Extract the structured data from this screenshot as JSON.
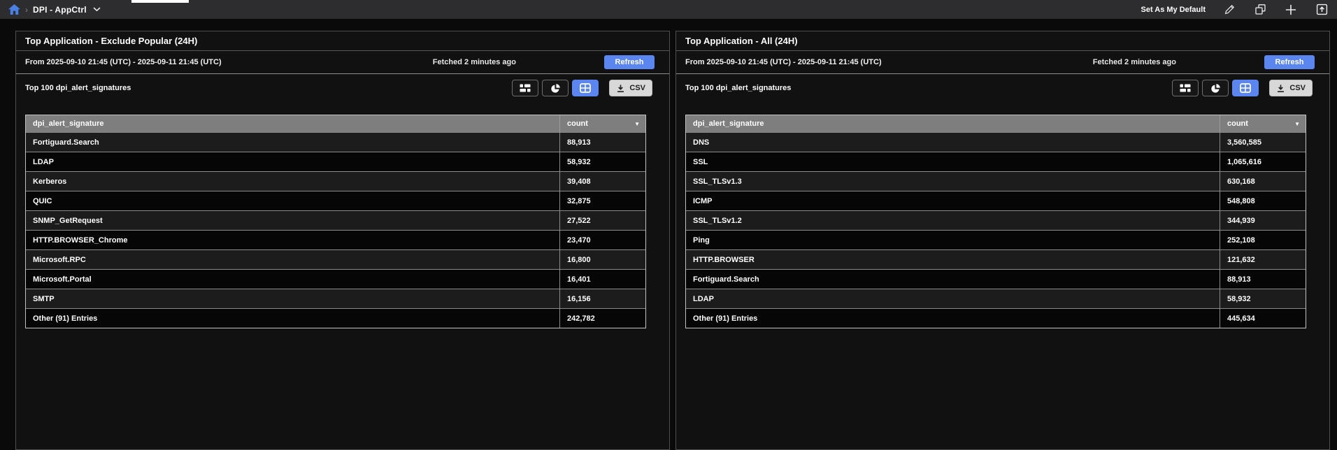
{
  "topbar": {
    "breadcrumb_title": "DPI - AppCtrl",
    "set_default_label": "Set As My Default",
    "icons": [
      "home-icon",
      "chevron-down-icon",
      "pencil-icon",
      "copy-icon",
      "plus-icon",
      "export-icon"
    ]
  },
  "colors": {
    "accent": "#5b86f0",
    "csv-bg": "#d8d8d8",
    "header-bg": "#7e7e7e",
    "topbar-bg": "#2d2d2f",
    "panel-border": "#4e4e4e"
  },
  "panels": [
    {
      "title": "Top Application - Exclude Popular (24H)",
      "date_range": "From 2025-09-10 21:45 (UTC) - 2025-09-11 21:45 (UTC)",
      "fetched": "Fetched 2 minutes ago",
      "refresh_label": "Refresh",
      "subtitle": "Top 100 dpi_alert_signatures",
      "csv_label": "CSV",
      "table": {
        "columns": [
          "dpi_alert_signature",
          "count"
        ],
        "sort_indicator": "▼",
        "rows": [
          [
            "Fortiguard.Search",
            "88,913"
          ],
          [
            "LDAP",
            "58,932"
          ],
          [
            "Kerberos",
            "39,408"
          ],
          [
            "QUIC",
            "32,875"
          ],
          [
            "SNMP_GetRequest",
            "27,522"
          ],
          [
            "HTTP.BROWSER_Chrome",
            "23,470"
          ],
          [
            "Microsoft.RPC",
            "16,800"
          ],
          [
            "Microsoft.Portal",
            "16,401"
          ],
          [
            "SMTP",
            "16,156"
          ],
          [
            "Other (91) Entries",
            "242,782"
          ]
        ]
      }
    },
    {
      "title": "Top Application - All (24H)",
      "date_range": "From 2025-09-10 21:45 (UTC) - 2025-09-11 21:45 (UTC)",
      "fetched": "Fetched 2 minutes ago",
      "refresh_label": "Refresh",
      "subtitle": "Top 100 dpi_alert_signatures",
      "csv_label": "CSV",
      "table": {
        "columns": [
          "dpi_alert_signature",
          "count"
        ],
        "sort_indicator": "▼",
        "rows": [
          [
            "DNS",
            "3,560,585"
          ],
          [
            "SSL",
            "1,065,616"
          ],
          [
            "SSL_TLSv1.3",
            "630,168"
          ],
          [
            "ICMP",
            "548,808"
          ],
          [
            "SSL_TLSv1.2",
            "344,939"
          ],
          [
            "Ping",
            "252,108"
          ],
          [
            "HTTP.BROWSER",
            "121,632"
          ],
          [
            "Fortiguard.Search",
            "88,913"
          ],
          [
            "LDAP",
            "58,932"
          ],
          [
            "Other (91) Entries",
            "445,634"
          ]
        ]
      }
    }
  ]
}
